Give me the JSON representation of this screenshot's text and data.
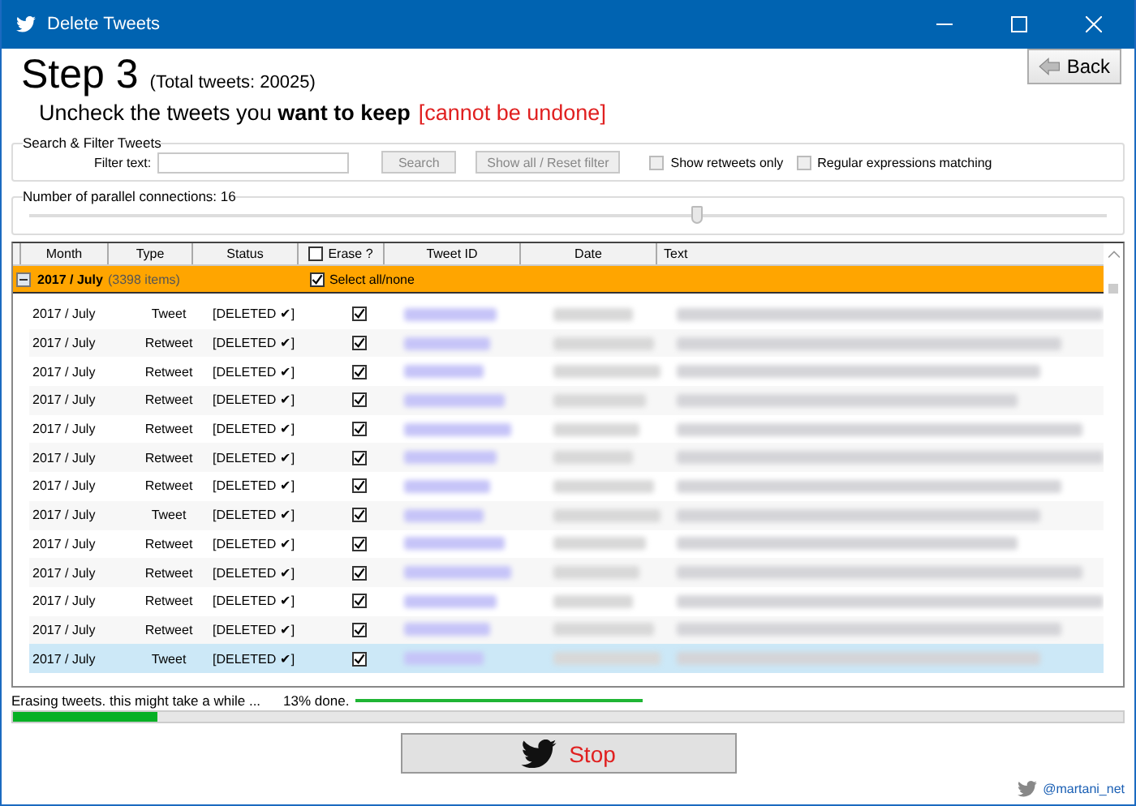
{
  "window": {
    "title": "Delete Tweets"
  },
  "header": {
    "step": "Step 3",
    "total": "(Total tweets: 20025)",
    "instruction": "Uncheck the tweets you **want to keep**",
    "warning": "[cannot be undone]",
    "back_button": "Back"
  },
  "filter": {
    "group_title": "Search & Filter Tweets",
    "filter_label": "Filter text:",
    "search_button": "Search",
    "reset_button": "Show all / Reset filter",
    "options": [
      {
        "label": "Show retweets only",
        "checked": false
      },
      {
        "label": "Regular expressions matching",
        "checked": false
      }
    ]
  },
  "connections": {
    "label": "Number of parallel connections: 16",
    "level": 0.62
  },
  "table": {
    "columns": [
      "Month",
      "Type",
      "Status",
      "Erase ?",
      "Tweet ID",
      "Date",
      "Text"
    ],
    "erase_header_checked": false,
    "group": {
      "title": "2017 / July",
      "count": "(3398 items)",
      "expanded": true,
      "select_label": "Select all/none",
      "select_checked": true
    },
    "rows": [
      {
        "month": "2017 / July",
        "type": "Tweet",
        "status": "[DELETED ✔]",
        "erase": true,
        "selected": false
      },
      {
        "month": "2017 / July",
        "type": "Retweet",
        "status": "[DELETED ✔]",
        "erase": true,
        "selected": false
      },
      {
        "month": "2017 / July",
        "type": "Retweet",
        "status": "[DELETED ✔]",
        "erase": true,
        "selected": false
      },
      {
        "month": "2017 / July",
        "type": "Retweet",
        "status": "[DELETED ✔]",
        "erase": true,
        "selected": false
      },
      {
        "month": "2017 / July",
        "type": "Retweet",
        "status": "[DELETED ✔]",
        "erase": true,
        "selected": false
      },
      {
        "month": "2017 / July",
        "type": "Retweet",
        "status": "[DELETED ✔]",
        "erase": true,
        "selected": false
      },
      {
        "month": "2017 / July",
        "type": "Retweet",
        "status": "[DELETED ✔]",
        "erase": true,
        "selected": false
      },
      {
        "month": "2017 / July",
        "type": "Tweet",
        "status": "[DELETED ✔]",
        "erase": true,
        "selected": false
      },
      {
        "month": "2017 / July",
        "type": "Retweet",
        "status": "[DELETED ✔]",
        "erase": true,
        "selected": false
      },
      {
        "month": "2017 / July",
        "type": "Retweet",
        "status": "[DELETED ✔]",
        "erase": true,
        "selected": false
      },
      {
        "month": "2017 / July",
        "type": "Retweet",
        "status": "[DELETED ✔]",
        "erase": true,
        "selected": false
      },
      {
        "month": "2017 / July",
        "type": "Retweet",
        "status": "[DELETED ✔]",
        "erase": true,
        "selected": false
      },
      {
        "month": "2017 / July",
        "type": "Tweet",
        "status": "[DELETED ✔]",
        "erase": true,
        "selected": true
      }
    ]
  },
  "progress": {
    "message": "Erasing tweets. this might take a while ...",
    "percent": "13% done.",
    "level": 0.13
  },
  "stop_button": "Stop",
  "footer": {
    "handle": "@martani_net"
  }
}
